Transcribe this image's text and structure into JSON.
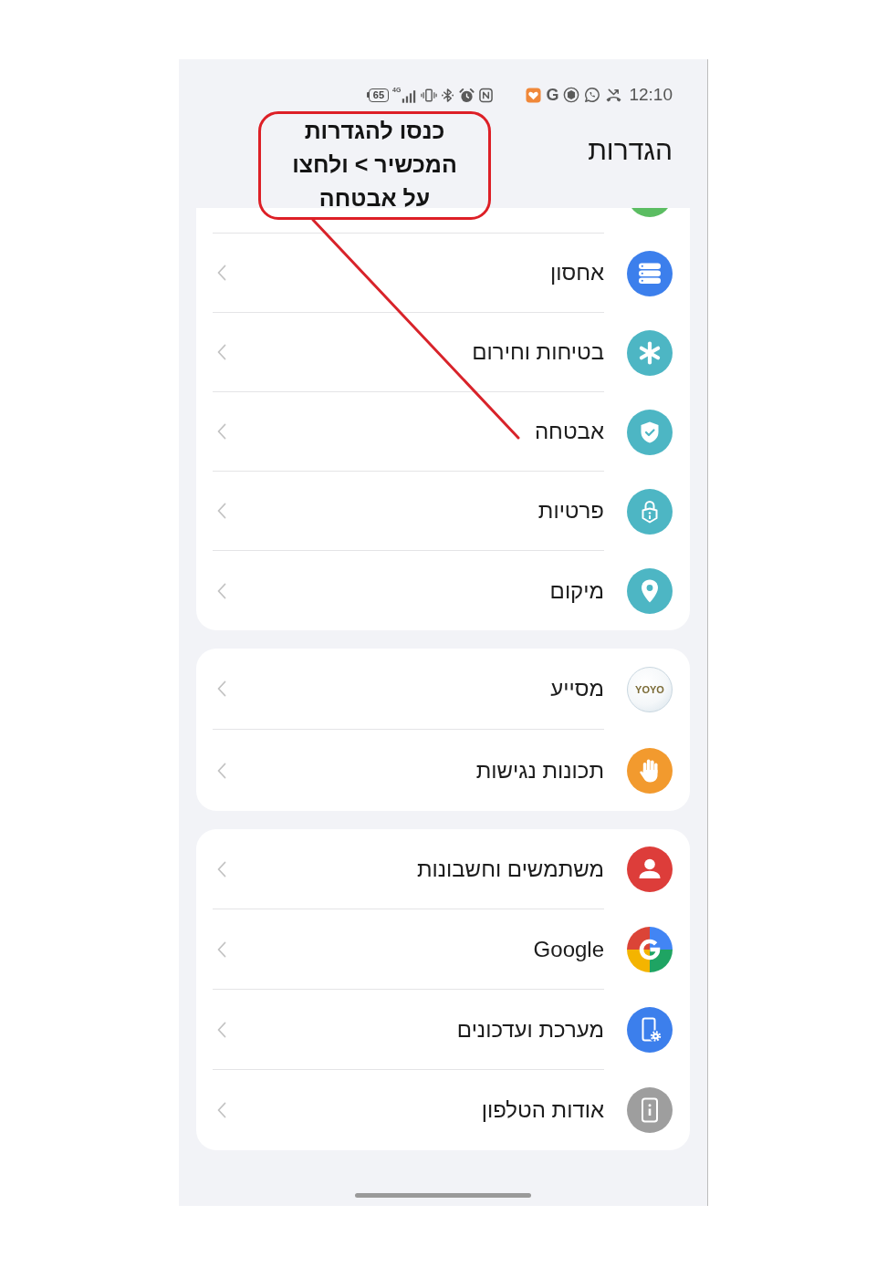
{
  "status_bar": {
    "battery": "65",
    "network": "4G",
    "notification_text": "G",
    "time": "12:10"
  },
  "header": {
    "title": "הגדרות"
  },
  "callout": {
    "text": "כנסו להגדרות\nהמכשיר > ולחצו\nעל אבטחה"
  },
  "groups": [
    {
      "scrolled": true,
      "items": [
        {
          "label": "אחסון"
        },
        {
          "label": "בטיחות וחירום"
        },
        {
          "label": "אבטחה"
        },
        {
          "label": "פרטיות"
        },
        {
          "label": "מיקום"
        }
      ]
    },
    {
      "scrolled": false,
      "items": [
        {
          "label": "מסייע",
          "logo_text": "YOYO"
        },
        {
          "label": "תכונות נגישות"
        }
      ]
    },
    {
      "scrolled": false,
      "items": [
        {
          "label": "משתמשים וחשבונות"
        },
        {
          "label": "Google"
        },
        {
          "label": "מערכת ועדכונים"
        },
        {
          "label": "אודות הטלפון"
        }
      ]
    }
  ]
}
